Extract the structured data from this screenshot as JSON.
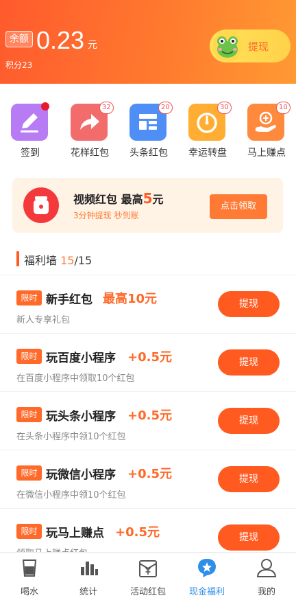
{
  "header": {
    "balance_label": "余额",
    "balance_amount": "0.23",
    "balance_unit": "元",
    "points": "积分23",
    "withdraw_label": "提现"
  },
  "quick": [
    {
      "label": "签到",
      "badge": "",
      "color": "#b77bf3",
      "icon": "pencil-icon"
    },
    {
      "label": "花样红包",
      "badge": "32",
      "color": "#f36c6c",
      "icon": "share-arrow-icon"
    },
    {
      "label": "头条红包",
      "badge": "20",
      "color": "#4f8ef5",
      "icon": "layout-grid-icon"
    },
    {
      "label": "幸运转盘",
      "badge": "30",
      "color": "#ffad33",
      "icon": "compass-dial-icon"
    },
    {
      "label": "马上赚点",
      "badge": "10",
      "color": "#ff8a3d",
      "icon": "hand-coin-icon"
    }
  ],
  "banner": {
    "title_prefix": "视频红包  最高",
    "title_amount": "5",
    "title_unit": "元",
    "subtitle": "3分钟提现 秒到账",
    "button": "点击领取"
  },
  "welfare": {
    "title": "福利墙",
    "count": "15",
    "total": "/15"
  },
  "tasks": [
    {
      "tag": "限时",
      "title": "新手红包",
      "reward": "最高10元",
      "desc": "新人专享礼包",
      "button": "提现"
    },
    {
      "tag": "限时",
      "title": "玩百度小程序",
      "reward": "+0.5元",
      "desc": "在百度小程序中领取10个红包",
      "button": "提现"
    },
    {
      "tag": "限时",
      "title": "玩头条小程序",
      "reward": "+0.5元",
      "desc": "在头条小程序中领10个红包",
      "button": "提现"
    },
    {
      "tag": "限时",
      "title": "玩微信小程序",
      "reward": "+0.5元",
      "desc": "在微信小程序中领10个红包",
      "button": "提现"
    },
    {
      "tag": "限时",
      "title": "玩马上赚点",
      "reward": "+0.5元",
      "desc": "领取马上赚点红包",
      "button": "提现"
    }
  ],
  "nav": [
    {
      "label": "喝水",
      "icon": "cup-icon"
    },
    {
      "label": "统计",
      "icon": "bar-chart-icon"
    },
    {
      "label": "活动红包",
      "icon": "receipt-yen-icon"
    },
    {
      "label": "现金福利",
      "icon": "star-bubble-icon",
      "active": true
    },
    {
      "label": "我的",
      "icon": "person-icon"
    }
  ],
  "colors": {
    "accent": "#ff5a20",
    "nav_active": "#2f8ee8"
  }
}
